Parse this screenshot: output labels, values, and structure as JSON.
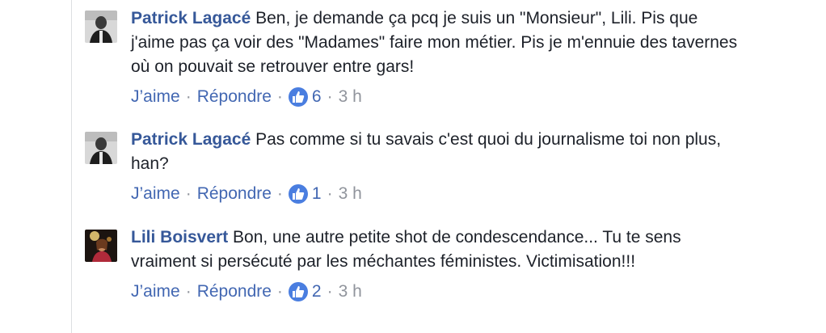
{
  "comments": [
    {
      "author": "Patrick Lagacé",
      "text": "Ben, je demande ça pcq je suis un \"Monsieur\", Lili. Pis que j'aime pas ça voir des \"Madames\" faire mon métier. Pis je m'ennuie des tavernes où on pouvait se retrouver entre gars!",
      "like_label": "J’aime",
      "reply_label": "Répondre",
      "likes": "6",
      "time": "3 h"
    },
    {
      "author": "Patrick Lagacé",
      "text": "Pas comme si tu savais c'est quoi du journalisme toi non plus, han?",
      "like_label": "J’aime",
      "reply_label": "Répondre",
      "likes": "1",
      "time": "3 h"
    },
    {
      "author": "Lili Boisvert",
      "text": "Bon, une autre petite shot de condescendance... Tu te sens vraiment si persécuté par les méchantes féministes. Victimisation!!!",
      "like_label": "J’aime",
      "reply_label": "Répondre",
      "likes": "2",
      "time": "3 h"
    }
  ],
  "separator": "·",
  "colors": {
    "author": "#365899",
    "text": "#1d2129",
    "link": "#4267b2",
    "meta": "#90949c",
    "like_badge": "#4a7ee0"
  },
  "icons": {
    "like": "thumbs-up-icon"
  }
}
